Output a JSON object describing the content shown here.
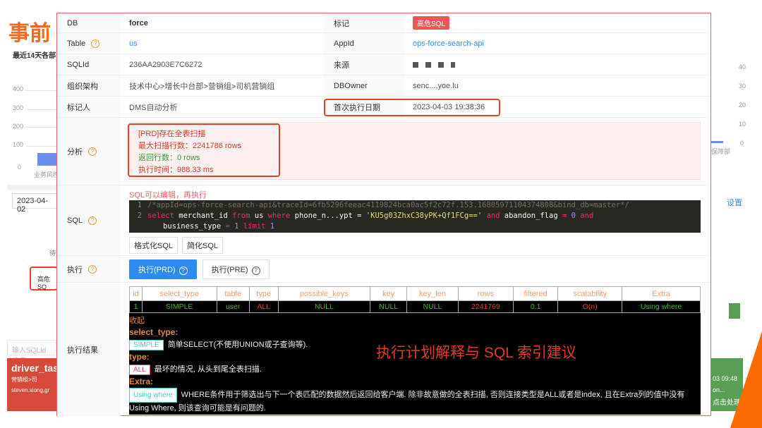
{
  "background": {
    "title": "事前",
    "chart_title": "最近14天各部",
    "yticks_left": [
      "400",
      "300",
      "200",
      "100",
      "0"
    ],
    "yticks_right": [
      "40",
      "30",
      "20",
      "10",
      "0"
    ],
    "xlabel_left": "业务风控",
    "xlabel_right": "保障部",
    "date": "2023-04-02",
    "settings": "设置",
    "pending": "待",
    "high_risk": "高危SQ",
    "search_placeholder": "输入SQLId搜索",
    "card_title": "driver_task",
    "card_org": "营销组>司",
    "card_owner": "steven.xiong,gr",
    "card_time": "03 09:48",
    "card_owner_right": "on...",
    "card_action": "点击处理"
  },
  "fields": {
    "db_label": "DB",
    "db": "force",
    "mark_label": "标记",
    "mark": "高危SQL",
    "table_label": "Table",
    "table": "us",
    "appid_label": "AppId",
    "appid": "ops-force-search-api",
    "sqlid_label": "SQLId",
    "sqlid": "236AA2903E7C6272",
    "source_label": "来源",
    "source": "",
    "org_label": "组织架构",
    "org": "技术中心>增长中台部>营销组>司机营销组",
    "dbowner_label": "DBOwner",
    "dbowner": "senc...,yoe.lu",
    "marker_label": "标记人",
    "marker": "DMS自动分析",
    "first_exec_label": "首次执行日期",
    "first_exec": "2023-04-03 19:38:36"
  },
  "analysis": {
    "label": "分析",
    "lines": [
      "[PRD]存在全表扫描",
      "最大扫描行数：2241786 rows",
      "返回行数：0 rows",
      "执行时间：988.33 ms"
    ]
  },
  "sql": {
    "label": "SQL",
    "hint": "SQL可以编辑，再执行",
    "line1": "/*appId=ops-force-search-api&traceId=6fb5296feeac4119824bca0ac5f2c72f.153.16805971104374808&bind_db=master*/",
    "line2a": "select",
    "line2b": " merchant_id ",
    "line2c": "from",
    "line2d": " us ",
    "line2e": "where",
    "line2f": " phone_n...ypt = ",
    "line2g": "'KU5g03ZhxC38yPK+Qf1FCg=='",
    "line2h": " and",
    "line2i": " abandon_flag ",
    "line2j": "= ",
    "line2k": "0",
    "line2l": " and",
    "line3a": "business_type ",
    "line3b": "= ",
    "line3c": "1",
    "line3d": " limit ",
    "line3e": "1",
    "format_btn": "格式化SQL",
    "simplify_btn": "简化SQL"
  },
  "execute": {
    "label": "执行",
    "prd": "执行(PRD)",
    "pre": "执行(PRE)"
  },
  "result": {
    "label": "执行结果",
    "headers": [
      "id",
      "select_type",
      "table",
      "type",
      "possible_keys",
      "key",
      "key_len",
      "rows",
      "filtered",
      "scalability",
      "Extra"
    ],
    "row": [
      "1",
      "SIMPLE",
      "user",
      "ALL",
      "NULL",
      "NULL",
      "NULL",
      "2241769",
      "0.1",
      "O(n)",
      "Using where"
    ],
    "collapse": "收起",
    "st_h": "select_type:",
    "st_pill": "SIMPLE",
    "st_desc": "简单SELECT(不使用UNION或子查询等).",
    "type_h": "type:",
    "type_pill": "ALL",
    "type_desc": "最坏的情况, 从头到尾全表扫描.",
    "extra_h": "Extra:",
    "extra_pill": "Using where",
    "extra_desc": "WHERE条件用于筛选出与下一个表匹配的数据然后返回给客户端. 除非故意做的全表扫描, 否则连接类型是ALL或者是index, 且在Extra列的值中没有Using Where, 则该查询可能是有问题的.",
    "annotation": "执行计划解释与 SQL 索引建议"
  }
}
